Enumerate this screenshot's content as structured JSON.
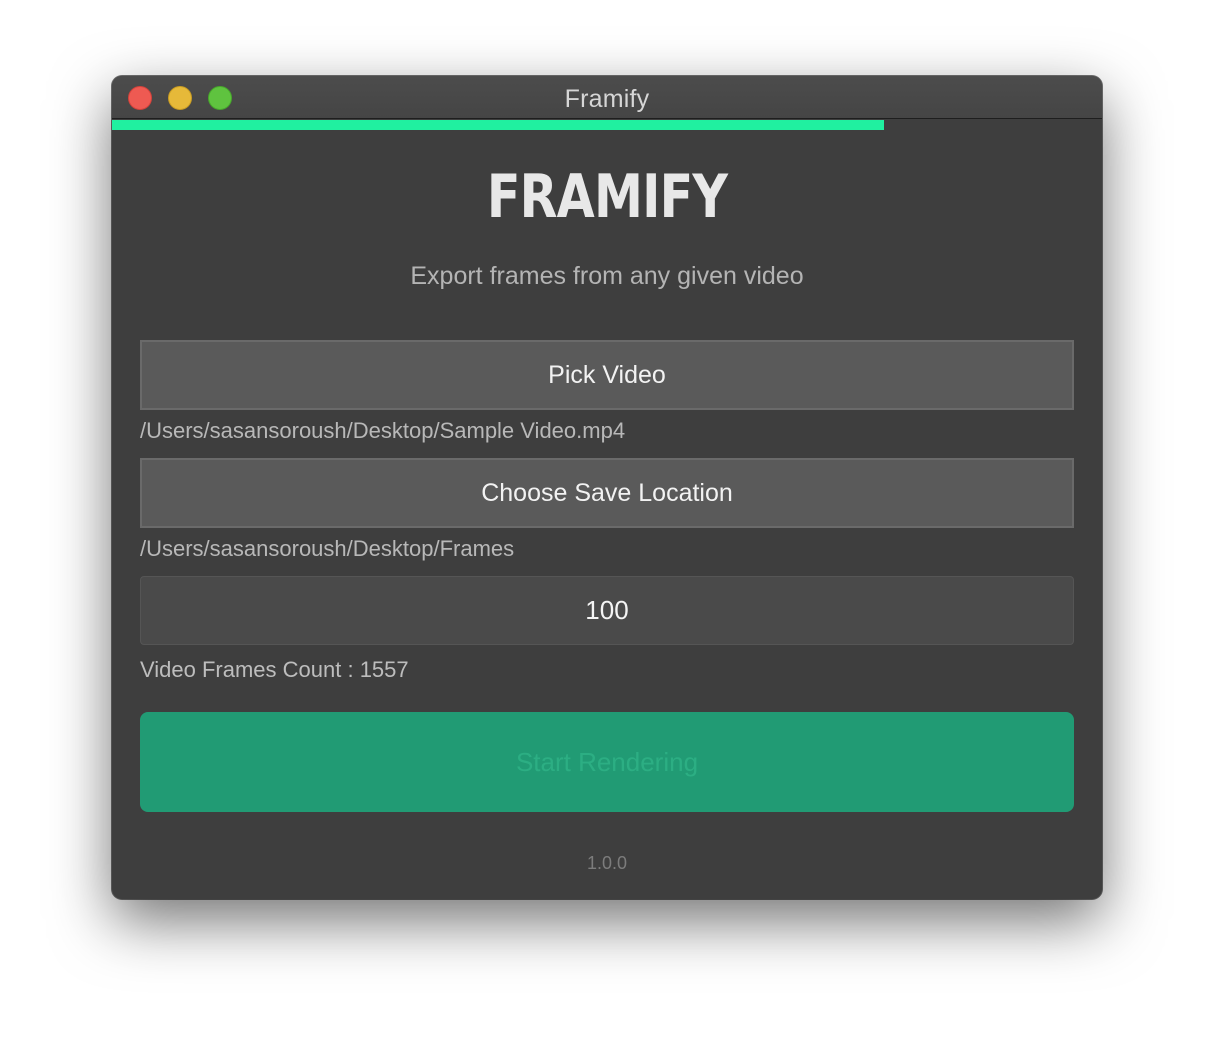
{
  "window": {
    "title": "Framify"
  },
  "progress": {
    "fraction": 0.78,
    "color": "#20f0a0"
  },
  "header": {
    "logo_text": "FRAMIFY",
    "subtitle": "Export frames from any given video"
  },
  "pick_video": {
    "label": "Pick Video",
    "selected_path": "/Users/sasansoroush/Desktop/Sample Video.mp4"
  },
  "save_location": {
    "label": "Choose Save Location",
    "selected_path": "/Users/sasansoroush/Desktop/Frames"
  },
  "frames_input": {
    "value": "100"
  },
  "frames_count": {
    "text": "Video Frames Count : 1557"
  },
  "render": {
    "label": "Start Rendering",
    "color": "#219b74"
  },
  "footer": {
    "version": "1.0.0"
  }
}
